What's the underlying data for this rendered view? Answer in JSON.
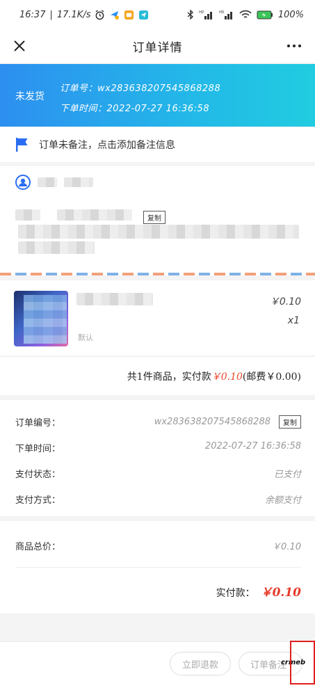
{
  "status_bar": {
    "time": "16:37",
    "speed": "17.1K/s",
    "battery": "100%"
  },
  "app_bar": {
    "title": "订单详情"
  },
  "banner": {
    "status": "未发货",
    "order_no_label": "订单号：",
    "order_no": "wx283638207545868288",
    "order_time_label": "下单时间：",
    "order_time": "2022-07-27 16:36:58"
  },
  "remark": {
    "text": "订单未备注，点击添加备注信息"
  },
  "address": {
    "copy_label": "复制"
  },
  "goods": {
    "spec": "默认",
    "price": "￥0.10",
    "qty": "x1"
  },
  "total": {
    "prefix": "共1件商品，实付款",
    "amount": "￥0.10",
    "shipping": "(邮费￥0.00)"
  },
  "info": {
    "rows": [
      {
        "label": "订单编号：",
        "value": "wx283638207545868288"
      },
      {
        "label": "下单时间：",
        "value": "2022-07-27 16:36:58"
      },
      {
        "label": "支付状态：",
        "value": "已支付"
      },
      {
        "label": "支付方式：",
        "value": "余额支付"
      }
    ],
    "copy_label": "复制"
  },
  "summary": {
    "goods_total_label": "商品总价：",
    "goods_total": "￥0.10",
    "paid_label": "实付款：",
    "paid_amount": "￥0.10"
  },
  "footer": {
    "refund_label": "立即退款",
    "remark_label": "订单备注",
    "watermark": "crmeb"
  },
  "colors": {
    "accent_red": "#e7482c",
    "banner_start": "#2d8ff0",
    "banner_end": "#21cce0",
    "flag_blue": "#2a6df4"
  }
}
